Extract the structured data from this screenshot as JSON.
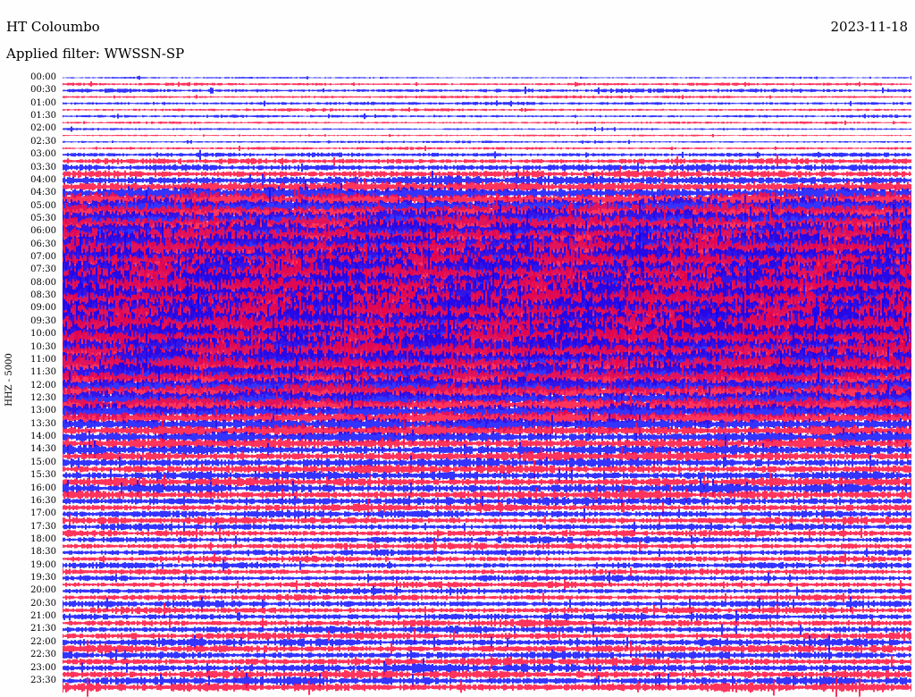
{
  "header": {
    "station": "HT Coloumbo",
    "date": "2023-11-18",
    "filter_text": "Applied filter: WWSSN-SP"
  },
  "channel_label": "HHZ - 5000",
  "colors": {
    "background": "#fefefe",
    "trace_blue": "#0000ff",
    "trace_red": "#ff0033",
    "text": "#000000"
  },
  "chart_data": {
    "type": "helicorder",
    "title": "HT Coloumbo",
    "date": "2023-11-18",
    "filter": "WWSSN-SP",
    "ylabel": "HHZ - 5000",
    "row_interval_minutes": 15,
    "color_cycle": [
      "#0000ff",
      "#ff0033"
    ],
    "time_labels": [
      "00:00",
      "00:30",
      "01:00",
      "01:30",
      "02:00",
      "02:30",
      "03:00",
      "03:30",
      "04:00",
      "04:30",
      "05:00",
      "05:30",
      "06:00",
      "06:30",
      "07:00",
      "07:30",
      "08:00",
      "08:30",
      "09:00",
      "09:30",
      "10:00",
      "10:30",
      "11:00",
      "11:30",
      "12:00",
      "12:30",
      "13:00",
      "13:30",
      "14:00",
      "14:30",
      "15:00",
      "15:30",
      "16:00",
      "16:30",
      "17:00",
      "17:30",
      "18:00",
      "18:30",
      "19:00",
      "19:30",
      "20:00",
      "20:30",
      "21:00",
      "21:30",
      "22:00",
      "22:30",
      "23:00",
      "23:30"
    ],
    "rows": [
      {
        "time": "00:00",
        "amp": 0.15
      },
      {
        "time": "00:15",
        "amp": 0.25
      },
      {
        "time": "00:30",
        "amp": 0.35
      },
      {
        "time": "00:45",
        "amp": 0.25
      },
      {
        "time": "01:00",
        "amp": 0.3
      },
      {
        "time": "01:15",
        "amp": 0.25
      },
      {
        "time": "01:30",
        "amp": 0.25
      },
      {
        "time": "01:45",
        "amp": 0.2
      },
      {
        "time": "02:00",
        "amp": 0.2
      },
      {
        "time": "02:15",
        "amp": 0.15
      },
      {
        "time": "02:30",
        "amp": 0.2
      },
      {
        "time": "02:45",
        "amp": 0.25
      },
      {
        "time": "03:00",
        "amp": 0.4
      },
      {
        "time": "03:15",
        "amp": 0.5
      },
      {
        "time": "03:30",
        "amp": 0.6
      },
      {
        "time": "03:45",
        "amp": 0.7
      },
      {
        "time": "04:00",
        "amp": 0.85
      },
      {
        "time": "04:15",
        "amp": 1.0
      },
      {
        "time": "04:30",
        "amp": 1.2
      },
      {
        "time": "04:45",
        "amp": 1.4
      },
      {
        "time": "05:00",
        "amp": 1.6
      },
      {
        "time": "05:15",
        "amp": 1.8
      },
      {
        "time": "05:30",
        "amp": 2.0
      },
      {
        "time": "05:45",
        "amp": 2.1
      },
      {
        "time": "06:00",
        "amp": 2.2
      },
      {
        "time": "06:15",
        "amp": 2.3
      },
      {
        "time": "06:30",
        "amp": 2.4
      },
      {
        "time": "06:45",
        "amp": 2.5
      },
      {
        "time": "07:00",
        "amp": 2.5
      },
      {
        "time": "07:15",
        "amp": 2.6
      },
      {
        "time": "07:30",
        "amp": 2.6
      },
      {
        "time": "07:45",
        "amp": 2.7
      },
      {
        "time": "08:00",
        "amp": 2.7
      },
      {
        "time": "08:15",
        "amp": 2.8
      },
      {
        "time": "08:30",
        "amp": 2.8
      },
      {
        "time": "08:45",
        "amp": 2.8
      },
      {
        "time": "09:00",
        "amp": 2.8
      },
      {
        "time": "09:15",
        "amp": 2.8
      },
      {
        "time": "09:30",
        "amp": 2.7
      },
      {
        "time": "09:45",
        "amp": 2.7
      },
      {
        "time": "10:00",
        "amp": 2.6
      },
      {
        "time": "10:15",
        "amp": 2.6
      },
      {
        "time": "10:30",
        "amp": 2.5
      },
      {
        "time": "10:45",
        "amp": 2.4
      },
      {
        "time": "11:00",
        "amp": 2.3
      },
      {
        "time": "11:15",
        "amp": 2.2
      },
      {
        "time": "11:30",
        "amp": 2.0
      },
      {
        "time": "11:45",
        "amp": 1.9
      },
      {
        "time": "12:00",
        "amp": 1.8
      },
      {
        "time": "12:15",
        "amp": 1.7
      },
      {
        "time": "12:30",
        "amp": 1.6
      },
      {
        "time": "12:45",
        "amp": 1.5
      },
      {
        "time": "13:00",
        "amp": 1.4
      },
      {
        "time": "13:15",
        "amp": 1.3
      },
      {
        "time": "13:30",
        "amp": 1.2
      },
      {
        "time": "13:45",
        "amp": 1.1
      },
      {
        "time": "14:00",
        "amp": 1.0
      },
      {
        "time": "14:15",
        "amp": 0.95
      },
      {
        "time": "14:30",
        "amp": 0.9
      },
      {
        "time": "14:45",
        "amp": 0.85
      },
      {
        "time": "15:00",
        "amp": 0.85
      },
      {
        "time": "15:15",
        "amp": 0.8
      },
      {
        "time": "15:30",
        "amp": 0.8
      },
      {
        "time": "15:45",
        "amp": 0.8
      },
      {
        "time": "16:00",
        "amp": 0.85
      },
      {
        "time": "16:15",
        "amp": 0.8
      },
      {
        "time": "16:30",
        "amp": 0.75
      },
      {
        "time": "16:45",
        "amp": 0.7
      },
      {
        "time": "17:00",
        "amp": 0.7
      },
      {
        "time": "17:15",
        "amp": 0.65
      },
      {
        "time": "17:30",
        "amp": 0.6
      },
      {
        "time": "17:45",
        "amp": 0.6
      },
      {
        "time": "18:00",
        "amp": 0.6
      },
      {
        "time": "18:15",
        "amp": 0.6
      },
      {
        "time": "18:30",
        "amp": 0.55
      },
      {
        "time": "18:45",
        "amp": 0.55
      },
      {
        "time": "19:00",
        "amp": 0.55
      },
      {
        "time": "19:15",
        "amp": 0.55
      },
      {
        "time": "19:30",
        "amp": 0.55
      },
      {
        "time": "19:45",
        "amp": 0.55
      },
      {
        "time": "20:00",
        "amp": 0.55
      },
      {
        "time": "20:15",
        "amp": 0.55
      },
      {
        "time": "20:30",
        "amp": 0.6
      },
      {
        "time": "20:45",
        "amp": 0.6
      },
      {
        "time": "21:00",
        "amp": 0.6
      },
      {
        "time": "21:15",
        "amp": 0.65
      },
      {
        "time": "21:30",
        "amp": 0.65
      },
      {
        "time": "21:45",
        "amp": 0.65
      },
      {
        "time": "22:00",
        "amp": 0.7
      },
      {
        "time": "22:15",
        "amp": 0.7
      },
      {
        "time": "22:30",
        "amp": 0.7
      },
      {
        "time": "22:45",
        "amp": 0.7
      },
      {
        "time": "23:00",
        "amp": 0.75
      },
      {
        "time": "23:15",
        "amp": 0.75
      },
      {
        "time": "23:30",
        "amp": 0.75
      },
      {
        "time": "23:45",
        "amp": 0.8
      }
    ]
  }
}
